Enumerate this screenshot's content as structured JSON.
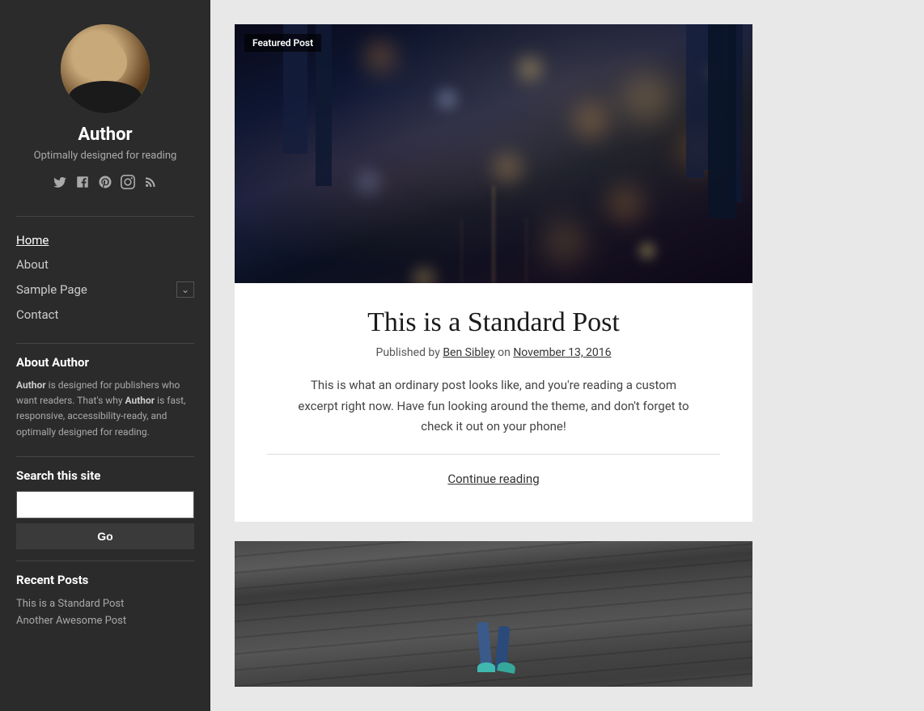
{
  "sidebar": {
    "author_name": "Author",
    "author_tagline": "Optimally designed for reading",
    "social_icons": [
      {
        "name": "twitter-icon",
        "symbol": "𝕏",
        "label": "Twitter"
      },
      {
        "name": "facebook-icon",
        "symbol": "f",
        "label": "Facebook"
      },
      {
        "name": "pinterest-icon",
        "symbol": "𝒫",
        "label": "Pinterest"
      },
      {
        "name": "instagram-icon",
        "symbol": "◻",
        "label": "Instagram"
      },
      {
        "name": "rss-icon",
        "symbol": "◉",
        "label": "RSS"
      }
    ],
    "nav_items": [
      {
        "label": "Home",
        "active": true,
        "has_dropdown": false
      },
      {
        "label": "About",
        "active": false,
        "has_dropdown": false
      },
      {
        "label": "Sample Page",
        "active": false,
        "has_dropdown": true
      },
      {
        "label": "Contact",
        "active": false,
        "has_dropdown": false
      }
    ],
    "about_widget_title": "About Author",
    "about_widget_text": "Author is designed for publishers who want readers. That's why Author is fast, responsive, accessibility-ready, and optimally designed for reading.",
    "about_text_bold1": "Author",
    "search_widget_title": "Search this site",
    "search_placeholder": "",
    "search_button_label": "Go",
    "recent_posts_title": "Recent Posts",
    "recent_posts": [
      {
        "label": "This is a Standard Post"
      },
      {
        "label": "Another Awesome Post"
      }
    ]
  },
  "main": {
    "post1": {
      "featured_badge": "Featured Post",
      "title": "This is a Standard Post",
      "meta_prefix": "Published by",
      "author_link": "Ben Sibley",
      "date_prefix": "on",
      "date_link": "November 13, 2016",
      "excerpt": "This is what an ordinary post looks like, and you're reading a custom excerpt right now. Have fun looking around the theme, and don't forget to check it out on your phone!",
      "continue_label": "Continue reading"
    }
  }
}
